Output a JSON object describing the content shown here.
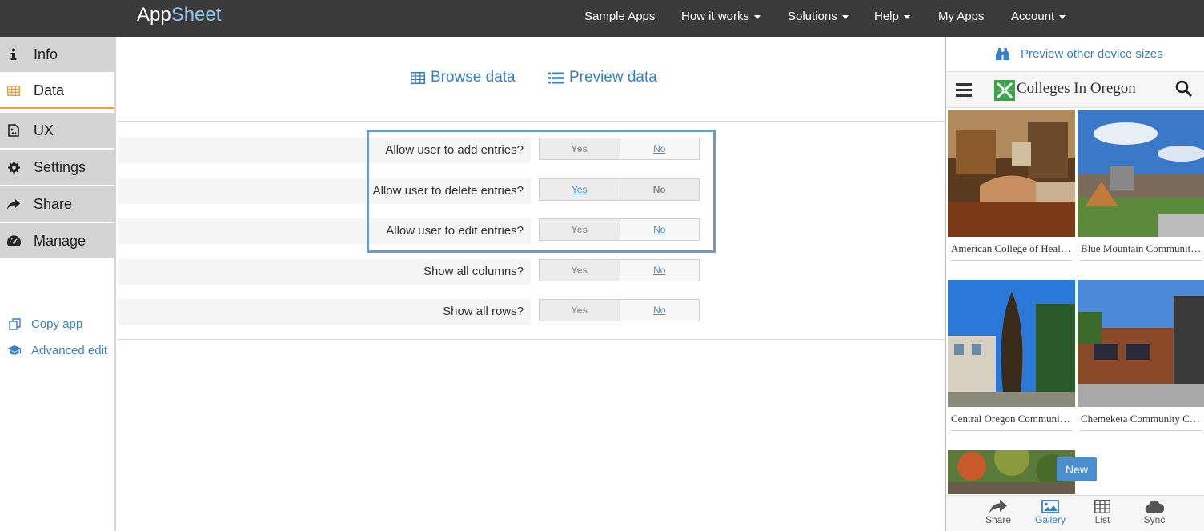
{
  "nav": {
    "logo_app": "App",
    "logo_sheet": "Sheet",
    "items": [
      {
        "label": "Sample Apps"
      },
      {
        "label": "How it works"
      },
      {
        "label": "Solutions"
      },
      {
        "label": "Help"
      },
      {
        "label": "My Apps"
      },
      {
        "label": "Account"
      }
    ]
  },
  "sidebar": {
    "items": [
      {
        "label": "Info",
        "icon": "info-icon"
      },
      {
        "label": "Data",
        "icon": "table-icon",
        "active": true
      },
      {
        "label": "UX",
        "icon": "image-icon"
      },
      {
        "label": "Settings",
        "icon": "gear-icon"
      },
      {
        "label": "Share",
        "icon": "share-icon"
      },
      {
        "label": "Manage",
        "icon": "dashboard-icon"
      }
    ],
    "links": [
      {
        "label": "Copy app",
        "icon": "copy-icon"
      },
      {
        "label": "Advanced edit",
        "icon": "graduation-cap-icon"
      }
    ]
  },
  "main": {
    "tabs": [
      {
        "label": "Browse data",
        "icon": "table-icon"
      },
      {
        "label": "Preview data",
        "icon": "list-icon"
      }
    ],
    "settings": [
      {
        "label": "Allow user to add entries?",
        "yes": "Yes",
        "no": "No",
        "selected": "Yes"
      },
      {
        "label": "Allow user to delete entries?",
        "yes": "Yes",
        "no": "No",
        "selected": "No"
      },
      {
        "label": "Allow user to edit entries?",
        "yes": "Yes",
        "no": "No",
        "selected": "Yes"
      },
      {
        "label": "Show all columns?",
        "yes": "Yes",
        "no": "No",
        "selected": "Yes"
      },
      {
        "label": "Show all rows?",
        "yes": "Yes",
        "no": "No",
        "selected": "Yes"
      }
    ]
  },
  "preview": {
    "link": "Preview other device sizes",
    "app_title": "Colleges In Oregon",
    "cards": [
      {
        "label": "American College of Healthcare Sciences"
      },
      {
        "label": "Blue Mountain Community College"
      },
      {
        "label": "Central Oregon Community College"
      },
      {
        "label": "Chemeketa Community College"
      }
    ],
    "new_button": "New",
    "bottom": [
      {
        "label": "Share",
        "icon": "share-icon"
      },
      {
        "label": "Gallery",
        "icon": "image-icon",
        "active": true
      },
      {
        "label": "List",
        "icon": "table-icon"
      },
      {
        "label": "Sync",
        "icon": "cloud-icon"
      }
    ]
  },
  "colors": {
    "nav_bg": "#3a3a3a",
    "accent": "#3a7fc0",
    "active_orange": "#f0a030",
    "highlight_border": "#6a9cc8"
  }
}
